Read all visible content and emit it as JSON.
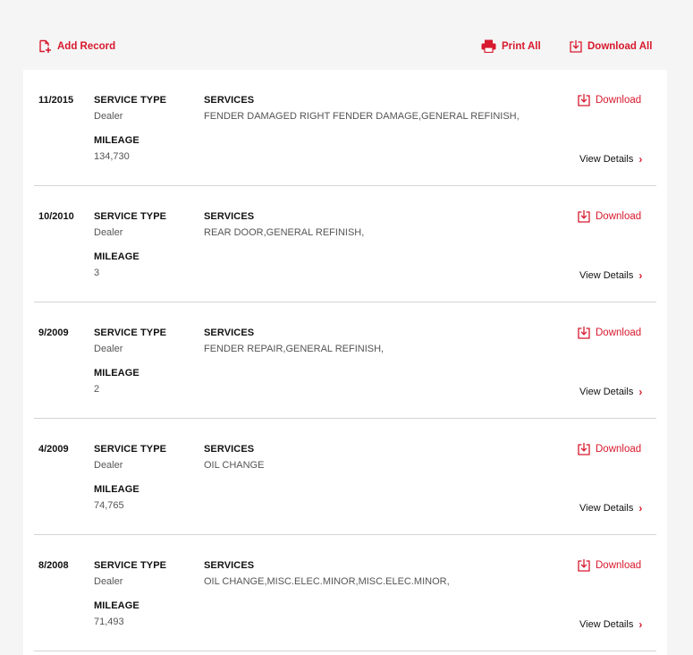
{
  "toolbar": {
    "add_record_label": "Add Record",
    "print_all_label": "Print All",
    "download_all_label": "Download All"
  },
  "labels": {
    "service_type": "SERVICE TYPE",
    "mileage": "MILEAGE",
    "services": "SERVICES",
    "download": "Download",
    "view_details": "View Details",
    "chevron": "›"
  },
  "colors": {
    "accent": "#d7192d",
    "background": "#f5f5f5",
    "card": "#ffffff",
    "divider": "#d4d4d4"
  },
  "icons": {
    "add_record": "add-document-icon",
    "print": "printer-icon",
    "download": "download-tray-icon",
    "chevron": "chevron-right-icon"
  },
  "records": [
    {
      "date": "11/2015",
      "service_type": "Dealer",
      "mileage": "134,730",
      "services": "FENDER DAMAGED RIGHT FENDER DAMAGE,GENERAL REFINISH,"
    },
    {
      "date": "10/2010",
      "service_type": "Dealer",
      "mileage": "3",
      "services": "REAR DOOR,GENERAL REFINISH,"
    },
    {
      "date": "9/2009",
      "service_type": "Dealer",
      "mileage": "2",
      "services": "FENDER REPAIR,GENERAL REFINISH,"
    },
    {
      "date": "4/2009",
      "service_type": "Dealer",
      "mileage": "74,765",
      "services": "OIL CHANGE"
    },
    {
      "date": "8/2008",
      "service_type": "Dealer",
      "mileage": "71,493",
      "services": "OIL CHANGE,MISC.ELEC.MINOR,MISC.ELEC.MINOR,"
    }
  ]
}
